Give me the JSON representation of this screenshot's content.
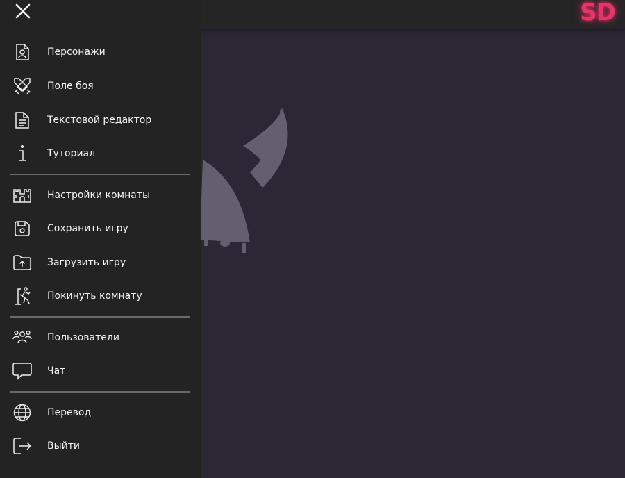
{
  "app": {
    "logo_text": "SD",
    "accent_color": "#e8336b"
  },
  "drawer": {
    "close_icon": "close-icon",
    "groups": [
      {
        "items": [
          {
            "label": "Персонажи",
            "icon": "character-sheet-icon"
          },
          {
            "label": "Поле боя",
            "icon": "crossed-swords-icon"
          },
          {
            "label": "Текстовой редактор",
            "icon": "document-icon"
          },
          {
            "label": "Туториал",
            "icon": "info-icon"
          }
        ]
      },
      {
        "items": [
          {
            "label": "Настройки комнаты",
            "icon": "castle-icon"
          },
          {
            "label": "Сохранить игру",
            "icon": "save-icon"
          },
          {
            "label": "Загрузить игру",
            "icon": "folder-upload-icon"
          },
          {
            "label": "Покинуть комнату",
            "icon": "leave-room-icon"
          }
        ]
      },
      {
        "items": [
          {
            "label": "Пользователи",
            "icon": "users-icon"
          },
          {
            "label": "Чат",
            "icon": "chat-icon"
          }
        ]
      },
      {
        "items": [
          {
            "label": "Перевод",
            "icon": "globe-icon"
          },
          {
            "label": "Выйти",
            "icon": "logout-icon"
          }
        ]
      }
    ]
  }
}
